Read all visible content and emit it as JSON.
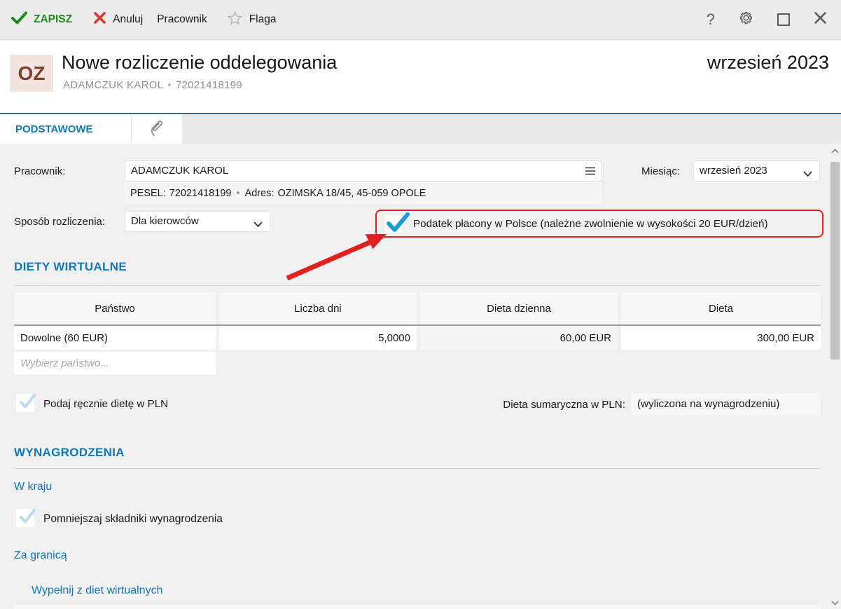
{
  "window": {
    "toolbar": {
      "save_label": "ZAPISZ",
      "cancel_label": "Anuluj",
      "employee_label": "Pracownik",
      "flag_label": "Flaga",
      "help_label": "?"
    },
    "header": {
      "badge": "OZ",
      "title": "Nowe rozliczenie oddelegowania",
      "employee_name": "ADAMCZUK KAROL",
      "separator": "•",
      "employee_id": "72021418199",
      "period": "wrzesień 2023"
    },
    "tabs": {
      "basic": "PODSTAWOWE"
    }
  },
  "form": {
    "employee": {
      "label": "Pracownik:",
      "value": "ADAMCZUK KAROL",
      "pesel_label": "PESEL:",
      "pesel_value": "72021418199",
      "separator": "•",
      "address_label": "Adres:",
      "address_value": "OZIMSKA 18/45, 45-059 OPOLE"
    },
    "month": {
      "label": "Miesiąc:",
      "value": "wrzesień 2023"
    },
    "settlement": {
      "label": "Sposób rozliczenia:",
      "value": "Dla kierowców"
    },
    "tax_checkbox": {
      "checked": true,
      "annotated": true,
      "label": "Podatek płacony w Polsce (należne zwolnienie w wysokości 20 EUR/dzień)"
    }
  },
  "virtual_diets": {
    "section_title": "DIETY WIRTUALNE",
    "table": {
      "columns": [
        "Państwo",
        "Liczba dni",
        "Dieta dzienna",
        "Dieta"
      ],
      "rows": [
        {
          "country": "Dowolne (60 EUR)",
          "days": "5,0000",
          "daily_diet": "60,00 EUR",
          "diet": "300,00 EUR"
        }
      ],
      "new_row_placeholder": "Wybierz państwo..."
    },
    "manual_diet_checkbox": {
      "checked": false,
      "label": "Podaj ręcznie dietę w PLN"
    },
    "summary": {
      "label": "Dieta sumaryczna w PLN:",
      "value": "(wyliczona na wynagrodzeniu)"
    }
  },
  "salaries": {
    "section_title": "WYNAGRODZENIA",
    "domestic_heading": "W kraju",
    "reduce_checkbox": {
      "checked": false,
      "label": "Pomniejszaj składniki wynagrodzenia"
    },
    "abroad_heading": "Za granicą",
    "fill_from_diets_link": "Wypełnij z diet wirtualnych"
  },
  "icons": {
    "save": "green-check",
    "cancel": "red-x",
    "flag": "star-outline",
    "help": "question-mark",
    "settings": "gear",
    "maximize": "square",
    "close": "x-mark",
    "attachments_tab": "paperclip",
    "employee_picker": "menu",
    "dropdown": "chevron-down",
    "checkbox_checked": "blue-check",
    "checkbox_unchecked": "light-blue-check",
    "scrollbar": "chevron-up",
    "annotation": "red-arrow"
  },
  "colors": {
    "accent_blue": "#1079b5",
    "check_blue": "#1d9ad6",
    "ghost_check_blue": "#b9dcee",
    "save_green": "#1e8a1e",
    "cancel_red": "#d93a31",
    "annotation_red": "#e01f1f",
    "badge_bg": "#f3e4e0",
    "badge_text": "#7c4031",
    "header_line_blue": "#38678a"
  }
}
